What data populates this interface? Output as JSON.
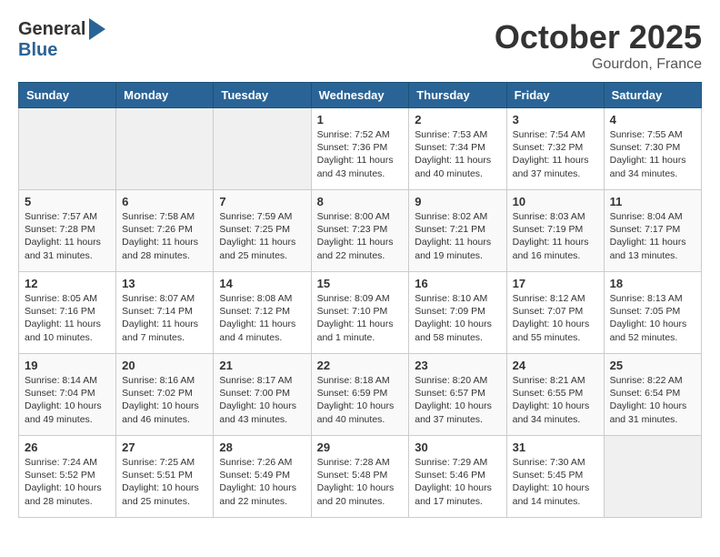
{
  "header": {
    "logo_general": "General",
    "logo_blue": "Blue",
    "month_title": "October 2025",
    "location": "Gourdon, France"
  },
  "days_of_week": [
    "Sunday",
    "Monday",
    "Tuesday",
    "Wednesday",
    "Thursday",
    "Friday",
    "Saturday"
  ],
  "weeks": [
    [
      {
        "day": "",
        "info": ""
      },
      {
        "day": "",
        "info": ""
      },
      {
        "day": "",
        "info": ""
      },
      {
        "day": "1",
        "info": "Sunrise: 7:52 AM\nSunset: 7:36 PM\nDaylight: 11 hours\nand 43 minutes."
      },
      {
        "day": "2",
        "info": "Sunrise: 7:53 AM\nSunset: 7:34 PM\nDaylight: 11 hours\nand 40 minutes."
      },
      {
        "day": "3",
        "info": "Sunrise: 7:54 AM\nSunset: 7:32 PM\nDaylight: 11 hours\nand 37 minutes."
      },
      {
        "day": "4",
        "info": "Sunrise: 7:55 AM\nSunset: 7:30 PM\nDaylight: 11 hours\nand 34 minutes."
      }
    ],
    [
      {
        "day": "5",
        "info": "Sunrise: 7:57 AM\nSunset: 7:28 PM\nDaylight: 11 hours\nand 31 minutes."
      },
      {
        "day": "6",
        "info": "Sunrise: 7:58 AM\nSunset: 7:26 PM\nDaylight: 11 hours\nand 28 minutes."
      },
      {
        "day": "7",
        "info": "Sunrise: 7:59 AM\nSunset: 7:25 PM\nDaylight: 11 hours\nand 25 minutes."
      },
      {
        "day": "8",
        "info": "Sunrise: 8:00 AM\nSunset: 7:23 PM\nDaylight: 11 hours\nand 22 minutes."
      },
      {
        "day": "9",
        "info": "Sunrise: 8:02 AM\nSunset: 7:21 PM\nDaylight: 11 hours\nand 19 minutes."
      },
      {
        "day": "10",
        "info": "Sunrise: 8:03 AM\nSunset: 7:19 PM\nDaylight: 11 hours\nand 16 minutes."
      },
      {
        "day": "11",
        "info": "Sunrise: 8:04 AM\nSunset: 7:17 PM\nDaylight: 11 hours\nand 13 minutes."
      }
    ],
    [
      {
        "day": "12",
        "info": "Sunrise: 8:05 AM\nSunset: 7:16 PM\nDaylight: 11 hours\nand 10 minutes."
      },
      {
        "day": "13",
        "info": "Sunrise: 8:07 AM\nSunset: 7:14 PM\nDaylight: 11 hours\nand 7 minutes."
      },
      {
        "day": "14",
        "info": "Sunrise: 8:08 AM\nSunset: 7:12 PM\nDaylight: 11 hours\nand 4 minutes."
      },
      {
        "day": "15",
        "info": "Sunrise: 8:09 AM\nSunset: 7:10 PM\nDaylight: 11 hours\nand 1 minute."
      },
      {
        "day": "16",
        "info": "Sunrise: 8:10 AM\nSunset: 7:09 PM\nDaylight: 10 hours\nand 58 minutes."
      },
      {
        "day": "17",
        "info": "Sunrise: 8:12 AM\nSunset: 7:07 PM\nDaylight: 10 hours\nand 55 minutes."
      },
      {
        "day": "18",
        "info": "Sunrise: 8:13 AM\nSunset: 7:05 PM\nDaylight: 10 hours\nand 52 minutes."
      }
    ],
    [
      {
        "day": "19",
        "info": "Sunrise: 8:14 AM\nSunset: 7:04 PM\nDaylight: 10 hours\nand 49 minutes."
      },
      {
        "day": "20",
        "info": "Sunrise: 8:16 AM\nSunset: 7:02 PM\nDaylight: 10 hours\nand 46 minutes."
      },
      {
        "day": "21",
        "info": "Sunrise: 8:17 AM\nSunset: 7:00 PM\nDaylight: 10 hours\nand 43 minutes."
      },
      {
        "day": "22",
        "info": "Sunrise: 8:18 AM\nSunset: 6:59 PM\nDaylight: 10 hours\nand 40 minutes."
      },
      {
        "day": "23",
        "info": "Sunrise: 8:20 AM\nSunset: 6:57 PM\nDaylight: 10 hours\nand 37 minutes."
      },
      {
        "day": "24",
        "info": "Sunrise: 8:21 AM\nSunset: 6:55 PM\nDaylight: 10 hours\nand 34 minutes."
      },
      {
        "day": "25",
        "info": "Sunrise: 8:22 AM\nSunset: 6:54 PM\nDaylight: 10 hours\nand 31 minutes."
      }
    ],
    [
      {
        "day": "26",
        "info": "Sunrise: 7:24 AM\nSunset: 5:52 PM\nDaylight: 10 hours\nand 28 minutes."
      },
      {
        "day": "27",
        "info": "Sunrise: 7:25 AM\nSunset: 5:51 PM\nDaylight: 10 hours\nand 25 minutes."
      },
      {
        "day": "28",
        "info": "Sunrise: 7:26 AM\nSunset: 5:49 PM\nDaylight: 10 hours\nand 22 minutes."
      },
      {
        "day": "29",
        "info": "Sunrise: 7:28 AM\nSunset: 5:48 PM\nDaylight: 10 hours\nand 20 minutes."
      },
      {
        "day": "30",
        "info": "Sunrise: 7:29 AM\nSunset: 5:46 PM\nDaylight: 10 hours\nand 17 minutes."
      },
      {
        "day": "31",
        "info": "Sunrise: 7:30 AM\nSunset: 5:45 PM\nDaylight: 10 hours\nand 14 minutes."
      },
      {
        "day": "",
        "info": ""
      }
    ]
  ]
}
